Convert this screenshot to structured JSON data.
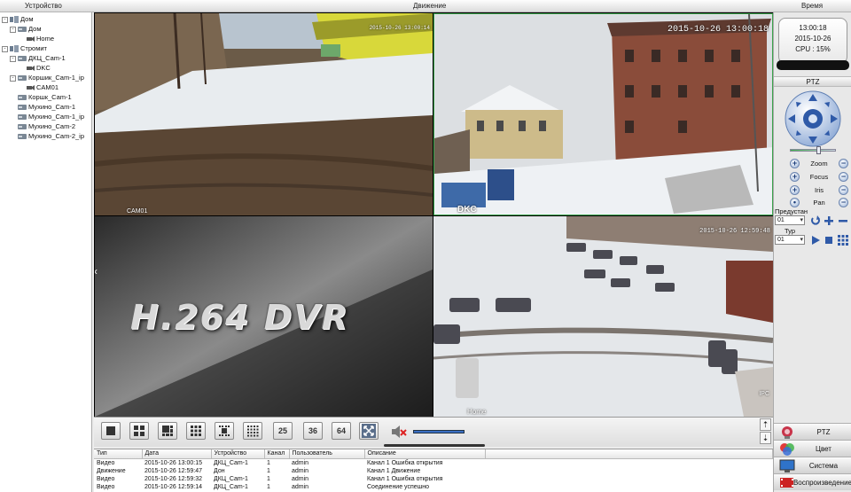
{
  "topbar": {
    "device": "Устройство",
    "motion": "Движение",
    "time": "Время"
  },
  "tree": {
    "items": [
      {
        "label": "Дом",
        "level": 0,
        "expander": "-",
        "icon": "group-icon"
      },
      {
        "label": "Дом",
        "level": 1,
        "expander": "-",
        "icon": "dvr-icon"
      },
      {
        "label": "Home",
        "level": 2,
        "expander": "",
        "icon": "camera-icon"
      },
      {
        "label": "Стромит",
        "level": 0,
        "expander": "-",
        "icon": "group-icon"
      },
      {
        "label": "ДКЦ_Cam-1",
        "level": 1,
        "expander": "-",
        "icon": "dvr-icon"
      },
      {
        "label": "DKC",
        "level": 2,
        "expander": "",
        "icon": "camera-icon"
      },
      {
        "label": "Коршик_Cam-1_ip",
        "level": 1,
        "expander": "-",
        "icon": "dvr-icon"
      },
      {
        "label": "CAM01",
        "level": 2,
        "expander": "",
        "icon": "camera-icon"
      },
      {
        "label": "Коршк_Cam-1",
        "level": 1,
        "expander": "",
        "icon": "dvr-icon"
      },
      {
        "label": "Мухино_Cam-1",
        "level": 1,
        "expander": "",
        "icon": "dvr-icon"
      },
      {
        "label": "Мухино_Cam-1_ip",
        "level": 1,
        "expander": "",
        "icon": "dvr-icon"
      },
      {
        "label": "Мухино_Cam-2",
        "level": 1,
        "expander": "",
        "icon": "dvr-icon"
      },
      {
        "label": "Мухино_Cam-2_ip",
        "level": 1,
        "expander": "",
        "icon": "dvr-icon"
      }
    ]
  },
  "video": {
    "tiles": [
      {
        "stamp": "2015-10-26 13:00:14",
        "camera": "CAM01"
      },
      {
        "stamp": "2015-10-26 13:00:18",
        "camera": "DKC"
      },
      {
        "title": "H.264 DVR"
      },
      {
        "stamp": "2015-10-26 12:59:48",
        "camera": "Home",
        "corner": "IPC"
      }
    ]
  },
  "layout_buttons": [
    "",
    "",
    "",
    "",
    "",
    "",
    "25",
    "36",
    "64",
    ""
  ],
  "log": {
    "columns": [
      "Тип",
      "Дата",
      "Устройство",
      "Канал",
      "Пользователь",
      "Описание"
    ],
    "rows": [
      [
        "Видео",
        "2015-10-26 13:00:15",
        "ДКЦ_Cam-1",
        "1",
        "admin",
        "Канал 1 Ошибка открытия"
      ],
      [
        "Движение",
        "2015-10-26 12:59:47",
        "Дон",
        "1",
        "admin",
        "Канал 1 Движение"
      ],
      [
        "Видео",
        "2015-10-26 12:59:32",
        "ДКЦ_Cam-1",
        "1",
        "admin",
        "Канал 1 Ошибка открытия"
      ],
      [
        "Видео",
        "2015-10-26 12:59:14",
        "ДКЦ_Cam-1",
        "1",
        "admin",
        "Соединение успешно"
      ]
    ]
  },
  "right": {
    "clock": {
      "time": "13:00:18",
      "date": "2015-10-26",
      "cpu": "CPU : 15%"
    },
    "ptz_title": "PTZ",
    "controls": [
      "Zoom",
      "Focus",
      "Iris",
      "Pan"
    ],
    "preset_label": "Предустан",
    "preset_value": "01",
    "tour_label": "Тур",
    "tour_value": "01",
    "menu": [
      "PTZ",
      "Цвет",
      "Система",
      "Воспроизведение"
    ]
  },
  "colors": {
    "panel": "#e8e8e8",
    "accent": "#3f6db3",
    "grid_bg": "#000000"
  }
}
